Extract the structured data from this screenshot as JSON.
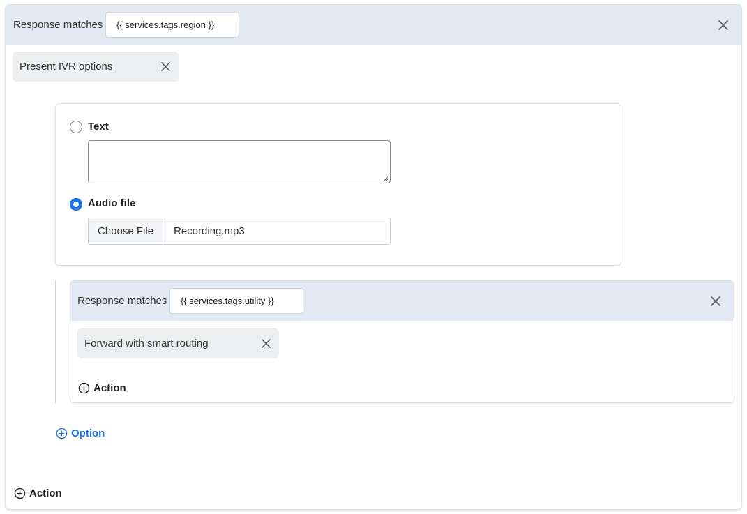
{
  "outer": {
    "header_label": "Response matches",
    "match_value": "{{ services.tags.region }}",
    "chip_label": "Present IVR options",
    "text_option_label": "Text",
    "text_value": "",
    "audio_option_label": "Audio file",
    "choose_file_label": "Choose File",
    "file_name": "Recording.mp3",
    "add_option_label": "Option",
    "add_action_label": "Action"
  },
  "inner": {
    "header_label": "Response matches",
    "match_value": "{{ services.tags.utility }}",
    "chip_label": "Forward with smart routing",
    "add_action_label": "Action"
  },
  "colors": {
    "header_bg": "#e3e9f2",
    "accent": "#1a73e8",
    "chip_bg": "#eceeef"
  }
}
